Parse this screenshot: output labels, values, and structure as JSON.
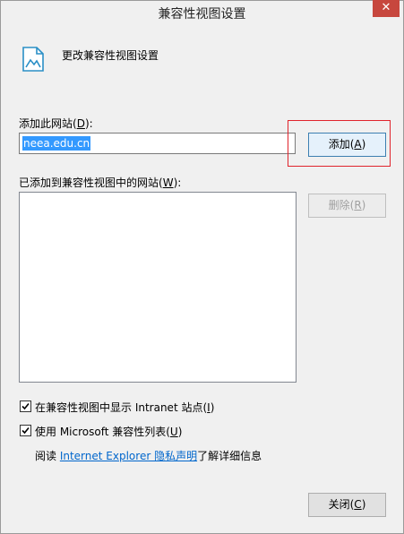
{
  "window": {
    "title": "兼容性视图设置",
    "close_glyph": "✕"
  },
  "header": {
    "text": "更改兼容性视图设置",
    "icon": "document-settings-icon"
  },
  "add_site": {
    "label_prefix": "添加此网站(",
    "label_key": "D",
    "label_suffix": "):",
    "value": "neea.edu.cn",
    "button_prefix": "添加(",
    "button_key": "A",
    "button_suffix": ")",
    "highlight_color": "#e0232b"
  },
  "added_sites": {
    "label_prefix": "已添加到兼容性视图中的网站(",
    "label_key": "W",
    "label_suffix": "):",
    "items": [],
    "remove_prefix": "删除(",
    "remove_key": "R",
    "remove_suffix": ")"
  },
  "options": {
    "intranet": {
      "checked": true,
      "label_prefix": "在兼容性视图中显示 Intranet 站点(",
      "label_key": "I",
      "label_suffix": ")"
    },
    "ms_list": {
      "checked": true,
      "label_prefix": "使用 Microsoft 兼容性列表(",
      "label_key": "U",
      "label_suffix": ")"
    }
  },
  "privacy": {
    "prefix": "阅读 ",
    "link": "Internet Explorer 隐私声明",
    "suffix": "了解详细信息"
  },
  "footer": {
    "close_prefix": "关闭(",
    "close_key": "C",
    "close_suffix": ")"
  }
}
